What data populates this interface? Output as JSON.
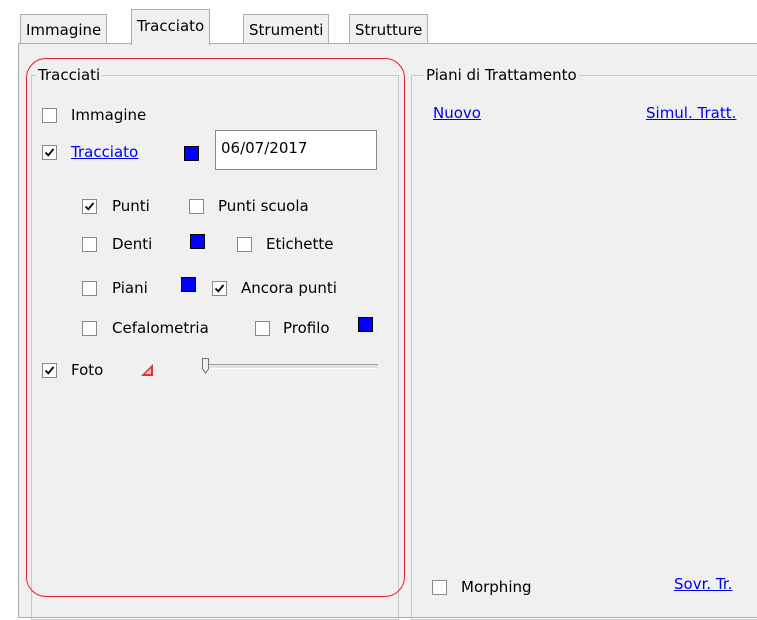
{
  "tabs": [
    {
      "label": "Immagine",
      "active": false
    },
    {
      "label": "Tracciato",
      "active": true
    },
    {
      "label": "Strumenti",
      "active": false
    },
    {
      "label": "Strutture",
      "active": false
    }
  ],
  "tracciati": {
    "title": "Tracciati",
    "immagine": {
      "label": "Immagine",
      "checked": false
    },
    "tracciato": {
      "label": "Tracciato",
      "checked": true,
      "date": "06/07/2017"
    },
    "punti": {
      "label": "Punti",
      "checked": true
    },
    "punti_scuola": {
      "label": "Punti scuola",
      "checked": false
    },
    "denti": {
      "label": "Denti",
      "checked": false
    },
    "etichette": {
      "label": "Etichette",
      "checked": false
    },
    "piani": {
      "label": "Piani",
      "checked": false
    },
    "ancora_punti": {
      "label": "Ancora punti",
      "checked": true
    },
    "cefalometria": {
      "label": "Cefalometria",
      "checked": false
    },
    "profilo": {
      "label": "Profilo",
      "checked": false
    },
    "foto": {
      "label": "Foto",
      "checked": true,
      "slider_value": 0
    },
    "swatch_color": "#0000ff"
  },
  "piani_trattamento": {
    "title": "Piani di Trattamento",
    "nuovo": "Nuovo",
    "simul_tratt": "Simul. Tratt.",
    "morphing": {
      "label": "Morphing",
      "checked": false
    },
    "sovr_tr": "Sovr. Tr."
  },
  "highlight_color": "#e0202a"
}
